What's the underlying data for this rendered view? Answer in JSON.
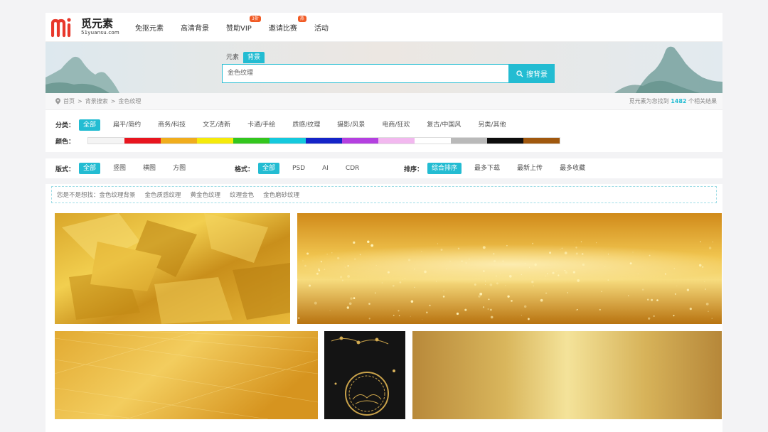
{
  "logo": {
    "name": "觅元素",
    "url": "51yuansu.com",
    "mark_letters": "mi"
  },
  "nav": [
    {
      "label": "免抠元素",
      "badge": ""
    },
    {
      "label": "高清背景",
      "badge": ""
    },
    {
      "label": "赞助VIP",
      "badge": "3折"
    },
    {
      "label": "邀请比赛",
      "badge": "热"
    },
    {
      "label": "活动",
      "badge": ""
    }
  ],
  "search": {
    "tabs": [
      {
        "label": "元素",
        "active": false
      },
      {
        "label": "背景",
        "active": true
      }
    ],
    "value": "金色纹理",
    "button_label": "搜背景"
  },
  "breadcrumb": {
    "items": [
      "首页",
      "背景搜索",
      "金色纹理"
    ],
    "separator": ">",
    "result_prefix": "觅元素为您找到",
    "result_count": "1482",
    "result_suffix": "个相关结果"
  },
  "filters": {
    "category_label": "分类：",
    "categories": [
      {
        "label": "全部",
        "active": true
      },
      {
        "label": "扁平/简约",
        "active": false
      },
      {
        "label": "商务/科技",
        "active": false
      },
      {
        "label": "文艺/清新",
        "active": false
      },
      {
        "label": "卡通/手绘",
        "active": false
      },
      {
        "label": "质感/纹理",
        "active": false
      },
      {
        "label": "摄影/风景",
        "active": false
      },
      {
        "label": "电商/狂欢",
        "active": false
      },
      {
        "label": "复古/中国风",
        "active": false
      },
      {
        "label": "另类/其他",
        "active": false
      }
    ],
    "color_label": "颜色：",
    "colors": [
      "#f4f4f4",
      "#e8151f",
      "#f0ad1d",
      "#f5ea0b",
      "#33c61e",
      "#14c9dd",
      "#1424c8",
      "#b440e0",
      "#f2b8ef",
      "#ffffff",
      "#b9b9b9",
      "#0d0d0d",
      "#a0580e"
    ],
    "layout_label": "版式：",
    "layouts": [
      {
        "label": "全部",
        "active": true
      },
      {
        "label": "竖图",
        "active": false
      },
      {
        "label": "横图",
        "active": false
      },
      {
        "label": "方图",
        "active": false
      }
    ],
    "format_label": "格式：",
    "formats": [
      {
        "label": "全部",
        "active": true
      },
      {
        "label": "PSD",
        "active": false
      },
      {
        "label": "AI",
        "active": false
      },
      {
        "label": "CDR",
        "active": false
      }
    ],
    "sort_label": "排序：",
    "sorts": [
      {
        "label": "综合排序",
        "active": true
      },
      {
        "label": "最多下载",
        "active": false
      },
      {
        "label": "最新上传",
        "active": false
      },
      {
        "label": "最多收藏",
        "active": false
      }
    ]
  },
  "suggest": {
    "prefix": "您是不是想找：",
    "items": [
      "金色纹理背景",
      "金色质感纹理",
      "黄金色纹理",
      "纹理金色",
      "金色磨砂纹理"
    ]
  },
  "tiles": [
    {
      "name": "gold-foil-texture-tile",
      "style": "foil"
    },
    {
      "name": "gold-glitter-tile",
      "style": "glitter"
    },
    {
      "name": "brushed-gold-tile",
      "style": "brushed"
    },
    {
      "name": "black-gold-chinese-tile",
      "style": "black"
    },
    {
      "name": "gold-gradient-tile",
      "style": "gradient"
    }
  ]
}
